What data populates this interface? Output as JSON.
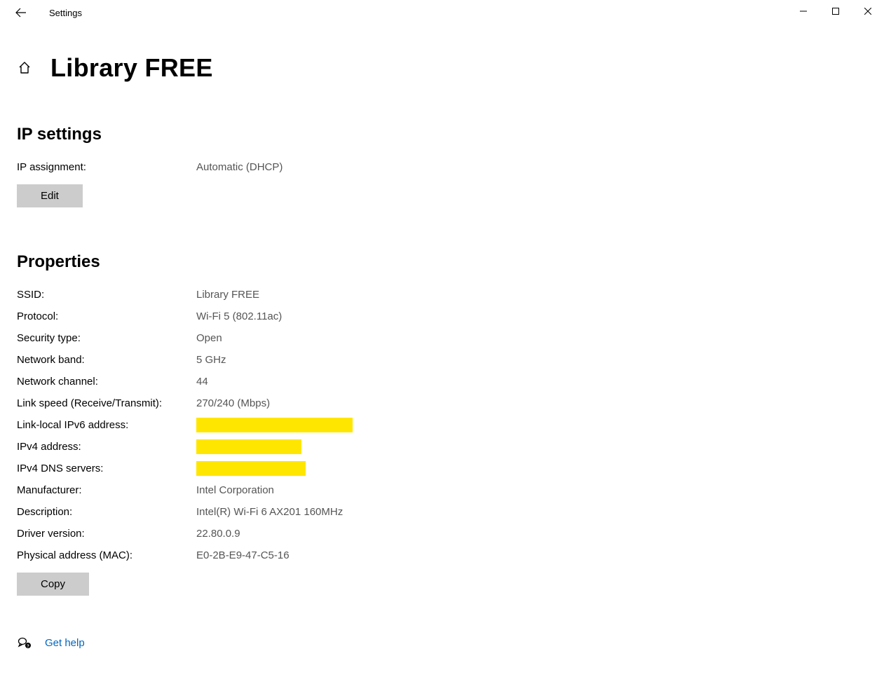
{
  "window": {
    "title": "Settings"
  },
  "header": {
    "page_title": "Library FREE"
  },
  "ip_settings": {
    "section_label": "IP settings",
    "assignment_label": "IP assignment:",
    "assignment_value": "Automatic (DHCP)",
    "edit_label": "Edit"
  },
  "properties": {
    "section_label": "Properties",
    "rows": [
      {
        "label": "SSID:",
        "value": "Library FREE"
      },
      {
        "label": "Protocol:",
        "value": "Wi-Fi 5 (802.11ac)"
      },
      {
        "label": "Security type:",
        "value": "Open"
      },
      {
        "label": "Network band:",
        "value": "5 GHz"
      },
      {
        "label": "Network channel:",
        "value": "44"
      },
      {
        "label": "Link speed (Receive/Transmit):",
        "value": "270/240 (Mbps)"
      },
      {
        "label": "Link-local IPv6 address:",
        "value": "",
        "redacted": "w1"
      },
      {
        "label": "IPv4 address:",
        "value": "",
        "redacted": "w2"
      },
      {
        "label": "IPv4 DNS servers:",
        "value": "",
        "redacted": "w3"
      },
      {
        "label": "Manufacturer:",
        "value": "Intel Corporation"
      },
      {
        "label": "Description:",
        "value": "Intel(R) Wi-Fi 6 AX201 160MHz"
      },
      {
        "label": "Driver version:",
        "value": "22.80.0.9"
      },
      {
        "label": "Physical address (MAC):",
        "value": "E0-2B-E9-47-C5-16"
      }
    ],
    "copy_label": "Copy"
  },
  "footer": {
    "help_label": "Get help"
  }
}
